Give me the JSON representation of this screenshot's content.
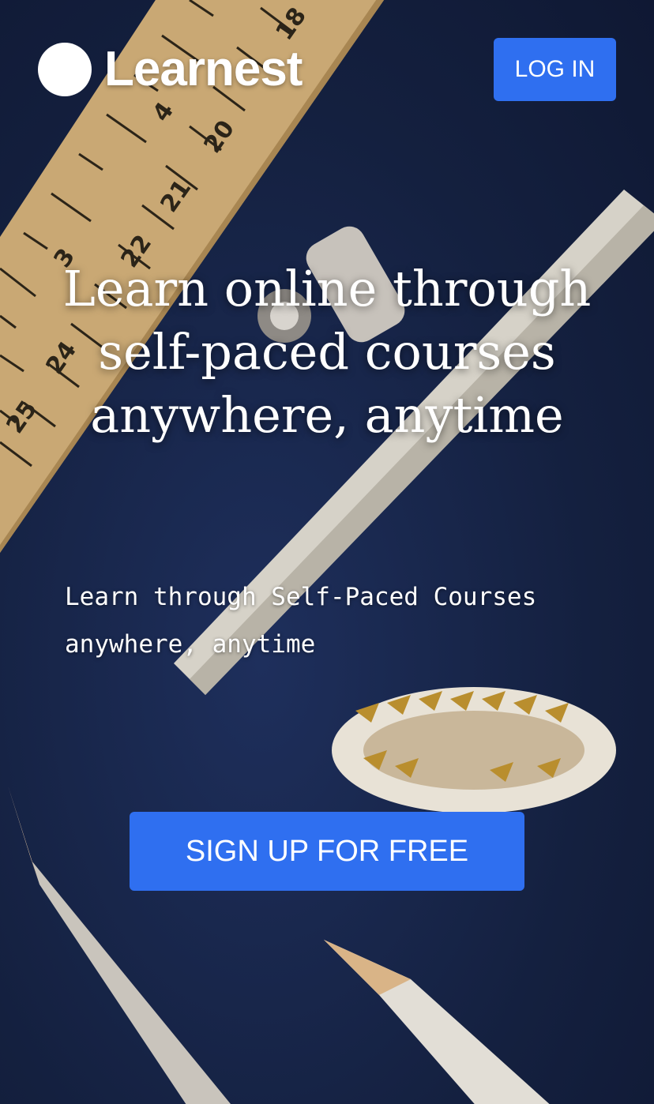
{
  "header": {
    "brand_name": "Learnest",
    "login_label": "LOG IN"
  },
  "hero": {
    "headline_line1": "Learn online through",
    "headline_line2": "self-paced courses",
    "headline_line3": "anywhere, anytime",
    "subtext_line1": "Learn through Self-Paced Courses",
    "subtext_line2": "anywhere, anytime",
    "cta_label": "SIGN UP FOR FREE",
    "ruler_numbers": [
      "18",
      "20",
      "21",
      "22",
      "24",
      "25",
      "3",
      "4"
    ]
  },
  "colors": {
    "background": "#17254a",
    "accent": "#2f6ff0",
    "text": "#ffffff"
  }
}
